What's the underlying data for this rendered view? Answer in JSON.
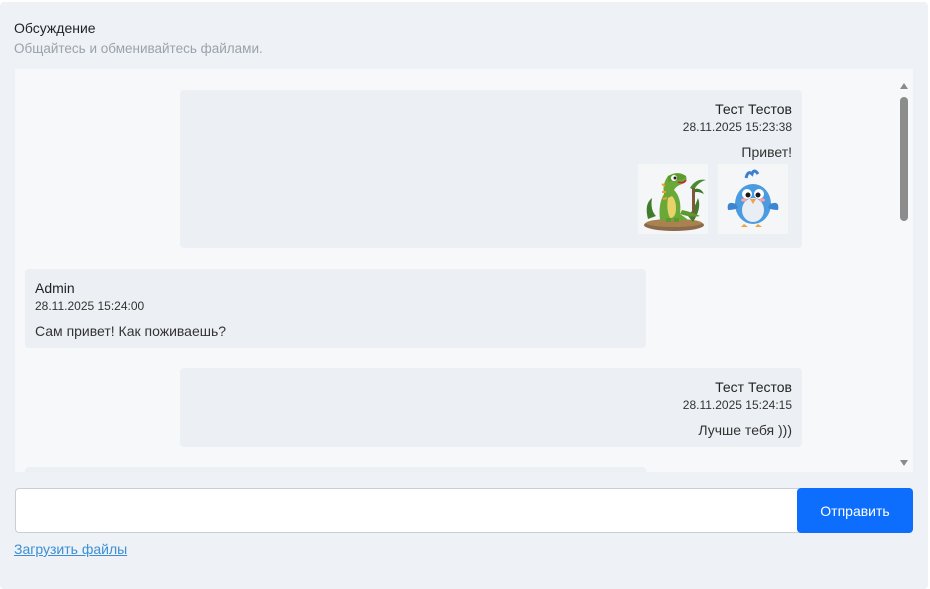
{
  "header": {
    "title": "Обсуждение",
    "subtitle": "Общайтесь и обменивайтесь файлами."
  },
  "messages": [
    {
      "side": "right",
      "author": "Тест Тестов",
      "time": "28.11.2025 15:23:38",
      "text": "Привет!",
      "attachments": [
        {
          "icon": "dinosaur-image"
        },
        {
          "icon": "bird-image"
        }
      ]
    },
    {
      "side": "left",
      "author": "Admin",
      "time": "28.11.2025 15:24:00",
      "text": "Сам привет! Как поживаешь?"
    },
    {
      "side": "right",
      "author": "Тест Тестов",
      "time": "28.11.2025 15:24:15",
      "text": "Лучше тебя )))"
    }
  ],
  "composer": {
    "value": "",
    "placeholder": "",
    "send_label": "Отправить",
    "upload_label": "Загрузить файлы"
  },
  "colors": {
    "accent": "#0d6efd",
    "link": "#3a8fd6",
    "panel": "#eef1f5",
    "bubble": "#eceff3"
  }
}
